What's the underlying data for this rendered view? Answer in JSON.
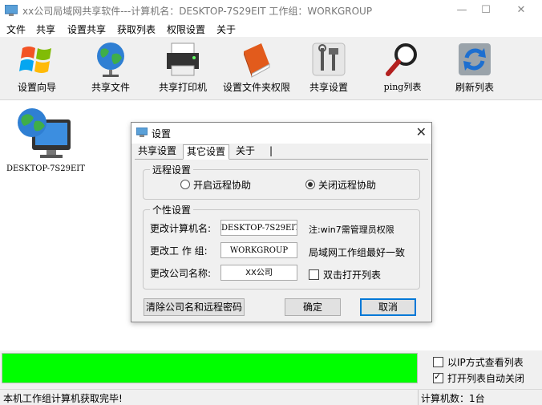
{
  "window": {
    "title": "xx公司局域网共享软件---计算机名：DESKTOP-7S29EIT   工作组：WORKGROUP",
    "minimize_label": "—",
    "maximize_label": "☐",
    "close_label": "✕"
  },
  "menu": [
    "文件",
    "共享",
    "设置共享",
    "获取列表",
    "权限设置",
    "关于"
  ],
  "toolbar": [
    {
      "label": "设置向导",
      "icon": "windows-logo-icon"
    },
    {
      "label": "共享文件",
      "icon": "globe-icon"
    },
    {
      "label": "共享打印机",
      "icon": "printer-icon"
    },
    {
      "label": "设置文件夹权限",
      "icon": "book-icon"
    },
    {
      "label": "共享设置",
      "icon": "tools-icon"
    },
    {
      "label": "ping列表",
      "icon": "magnifier-icon"
    },
    {
      "label": "刷新列表",
      "icon": "refresh-icon"
    }
  ],
  "computers": [
    {
      "name": "DESKTOP-7S29EIT"
    }
  ],
  "dialog": {
    "title": "设置",
    "close_label": "✕",
    "tabs": [
      "共享设置",
      "其它设置",
      "关于"
    ],
    "active_tab": "其它设置",
    "remote": {
      "group_title": "远程设置",
      "options": [
        {
          "label": "开启远程协助",
          "selected": false
        },
        {
          "label": "关闭远程协助",
          "selected": true
        }
      ]
    },
    "personal": {
      "group_title": "个性设置",
      "computer_name_label": "更改计算机名:",
      "computer_name_value": "DESKTOP-7S29EIT",
      "computer_name_note": "注:win7需管理员权限",
      "workgroup_label": "更改工 作 组:",
      "workgroup_value": "WORKGROUP",
      "workgroup_note": "局域网工作组最好一致",
      "company_label": "更改公司名称:",
      "company_value": "XX公司",
      "double_click_label": "双击打开列表",
      "double_click_checked": false
    },
    "buttons": {
      "clear": "清除公司名和远程密码",
      "ok": "确定",
      "cancel": "取消"
    }
  },
  "progress": {
    "fill_fraction": 1.0,
    "color": "#00ff00"
  },
  "options": {
    "ip_view_label": "以IP方式查看列表",
    "ip_view_checked": false,
    "auto_close_label": "打开列表自动关闭",
    "auto_close_checked": true
  },
  "status": {
    "message": "本机工作组计算机获取完毕!",
    "count": "计算机数：1台"
  }
}
